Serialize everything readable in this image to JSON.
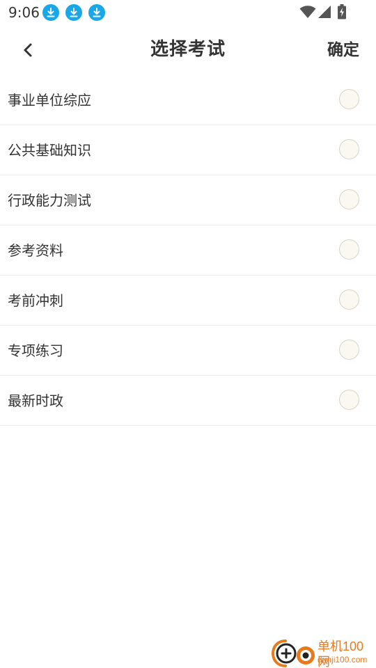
{
  "status_bar": {
    "time": "9:06",
    "notification_icons": [
      "download-icon",
      "download-icon",
      "download-icon"
    ],
    "accent": "#1aa7e8"
  },
  "header": {
    "title": "选择考试",
    "confirm_label": "确定",
    "back_icon": "chevron-left-icon"
  },
  "options": [
    {
      "label": "事业单位综应",
      "selected": false
    },
    {
      "label": "公共基础知识",
      "selected": false
    },
    {
      "label": "行政能力测试",
      "selected": false
    },
    {
      "label": "参考资料",
      "selected": false
    },
    {
      "label": "考前冲刺",
      "selected": false
    },
    {
      "label": "专项练习",
      "selected": false
    },
    {
      "label": "最新时政",
      "selected": false
    }
  ],
  "watermark": {
    "name": "单机100网",
    "domain": "danji100.com",
    "color": "#e87a1e"
  }
}
